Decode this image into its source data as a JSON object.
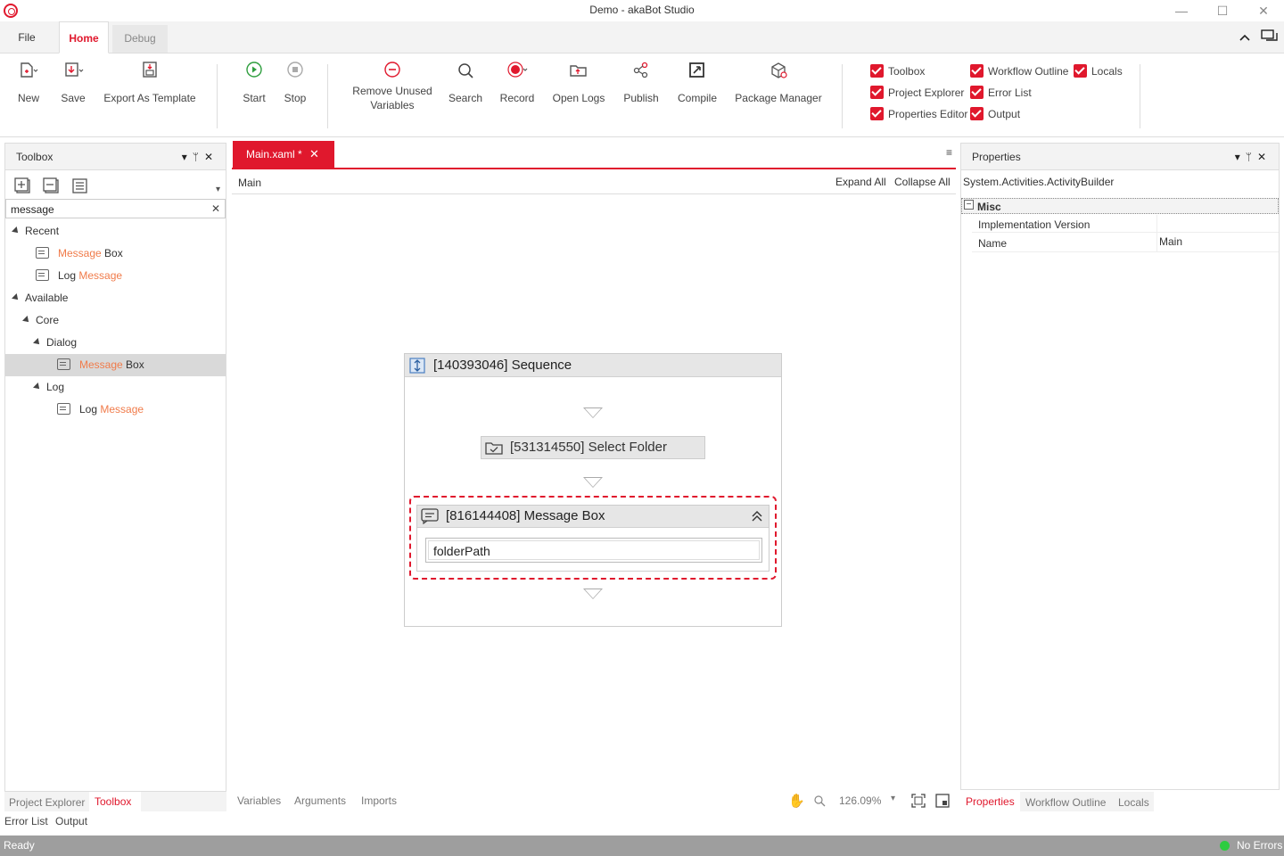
{
  "window": {
    "title": "Demo - akaBot Studio",
    "minimize": "—",
    "maximize": "☐",
    "close": "✕"
  },
  "ribbon_tabs": {
    "file": "File",
    "home": "Home",
    "debug": "Debug"
  },
  "ribbon": {
    "new": "New",
    "save": "Save",
    "export_template": "Export As Template",
    "start": "Start",
    "stop": "Stop",
    "remove_unused_line1": "Remove Unused",
    "remove_unused_line2": "Variables",
    "search": "Search",
    "record": "Record",
    "open_logs": "Open Logs",
    "publish": "Publish",
    "compile": "Compile",
    "package_manager": "Package Manager"
  },
  "view_toggles": {
    "toolbox": "Toolbox",
    "project_explorer": "Project Explorer",
    "properties_editor": "Properties Editor",
    "workflow_outline": "Workflow Outline",
    "error_list": "Error List",
    "output": "Output",
    "locals": "Locals"
  },
  "toolbox": {
    "title": "Toolbox",
    "search_value": "message",
    "recent": "Recent",
    "available": "Available",
    "core": "Core",
    "dialog": "Dialog",
    "log": "Log",
    "hl_message": "Message",
    "box_suffix": " Box",
    "log_prefix": "Log "
  },
  "left_tabs": {
    "project_explorer": "Project Explorer",
    "toolbox": "Toolbox",
    "error_list": "Error List",
    "output": "Output"
  },
  "designer": {
    "doc_tab": "Main.xaml *",
    "breadcrumb": "Main",
    "expand_all": "Expand All",
    "collapse_all": "Collapse All",
    "sequence_title": "[140393046] Sequence",
    "select_folder_title": "[531314550] Select Folder",
    "message_box_title": "[816144408] Message Box",
    "message_box_text": "folderPath",
    "bottom_variables": "Variables",
    "bottom_arguments": "Arguments",
    "bottom_imports": "Imports",
    "zoom": "126.09%"
  },
  "properties": {
    "title": "Properties",
    "type_name": "System.Activities.ActivityBuilder",
    "category": "Misc",
    "rows": [
      {
        "name": "Implementation Version",
        "value": ""
      },
      {
        "name": "Name",
        "value": "Main"
      }
    ]
  },
  "right_tabs": {
    "properties": "Properties",
    "workflow_outline": "Workflow Outline",
    "locals": "Locals"
  },
  "status": {
    "left": "Ready",
    "right": "No Errors"
  },
  "colors": {
    "accent": "#e0182d",
    "highlight": "#f07b4a",
    "status_ok": "#2ecc40",
    "statusbar": "#9e9e9e"
  }
}
